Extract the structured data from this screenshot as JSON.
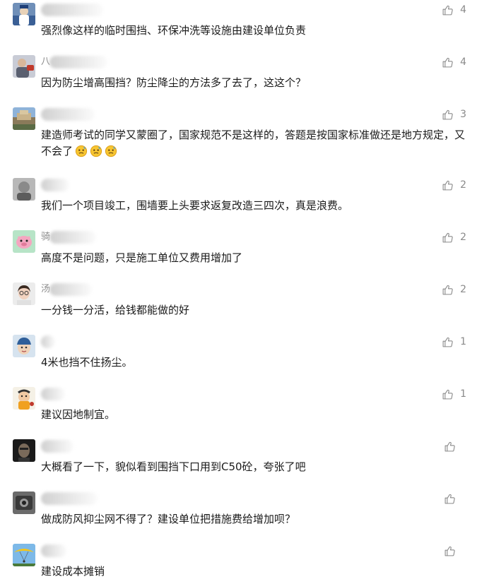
{
  "accent_color": "#8a8a8a",
  "like_icon": "thumbs-up-icon",
  "comments": [
    {
      "name": "",
      "text": "强烈像这样的临时围挡、环保冲洗等设施由建设单位负责",
      "likes": "4"
    },
    {
      "name": "八",
      "text": "因为防尘增高围挡？防尘降尘的方法多了去了，这这个？",
      "likes": "4"
    },
    {
      "name": "",
      "text": "建造师考试的同学又蒙圈了，国家规范不是这样的，答题是按国家标准做还是地方规定，又不会了",
      "likes": "3"
    },
    {
      "name": "",
      "text": "我们一个项目竣工，围墙要上头要求返复改造三四次，真是浪费。",
      "likes": "2"
    },
    {
      "name": "骑",
      "text": "高度不是问题，只是施工单位又费用增加了",
      "likes": "2"
    },
    {
      "name": "汤",
      "text": "一分钱一分活，给钱都能做的好",
      "likes": "2"
    },
    {
      "name": "",
      "text": "4米也挡不住扬尘。",
      "likes": "1"
    },
    {
      "name": "",
      "text": "建议因地制宜。",
      "likes": "1"
    },
    {
      "name": "",
      "text": "大概看了一下，貌似看到围挡下口用到C50砼，夸张了吧",
      "likes": ""
    },
    {
      "name": "",
      "text": "做成防风抑尘网不得了？建设单位把措施费给增加呗？",
      "likes": ""
    },
    {
      "name": "",
      "text": "建设成本摊销",
      "likes": ""
    }
  ]
}
